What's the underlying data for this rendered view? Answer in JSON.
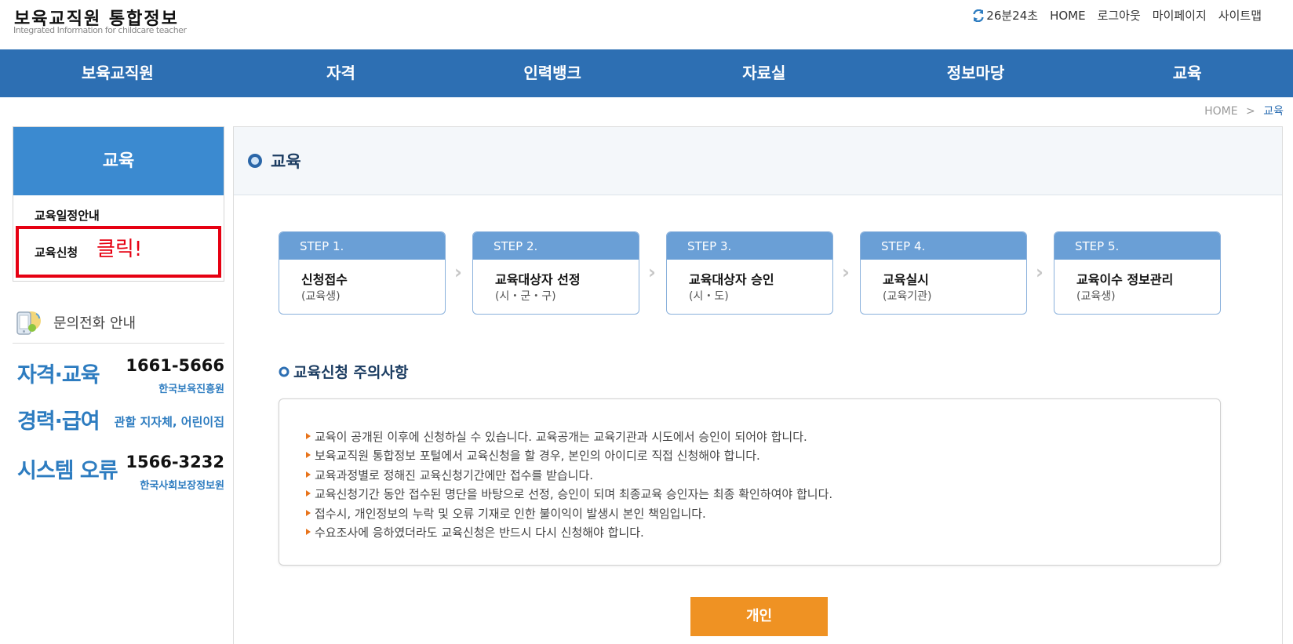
{
  "header": {
    "logo_title": "보육교직원 통합정보",
    "logo_subtitle": "Integrated Information for childcare teacher",
    "timer": "26분24초",
    "links": [
      "HOME",
      "로그아웃",
      "마이페이지",
      "사이트맵"
    ]
  },
  "gnb": [
    "보육교직원",
    "자격",
    "인력뱅크",
    "자료실",
    "정보마당",
    "교육"
  ],
  "breadcrumb": {
    "home": "HOME",
    "separator": ">",
    "current": "교육"
  },
  "sidebar": {
    "title": "교육",
    "items": [
      "교육일정안내",
      "교육신청"
    ],
    "annotation": "클릭!",
    "contact_title": "문의전화 안내",
    "contacts": [
      {
        "category": "자격·교육",
        "phone": "1661-5666",
        "org": "한국보육진흥원"
      },
      {
        "category": "경력·급여",
        "note": "관할 지자체, 어린이집"
      },
      {
        "category": "시스템 오류",
        "phone": "1566-3232",
        "org": "한국사회보장정보원"
      }
    ]
  },
  "main": {
    "title": "교육",
    "steps": [
      {
        "label": "STEP 1.",
        "title": "신청접수",
        "sub": "(교육생)"
      },
      {
        "label": "STEP 2.",
        "title": "교육대상자 선정",
        "sub": "(시・군・구)"
      },
      {
        "label": "STEP 3.",
        "title": "교육대상자 승인",
        "sub": "(시・도)"
      },
      {
        "label": "STEP 4.",
        "title": "교육실시",
        "sub": "(교육기관)"
      },
      {
        "label": "STEP 5.",
        "title": "교육이수 정보관리",
        "sub": "(교육생)"
      }
    ],
    "step_arrow": "›",
    "notice_title": "교육신청 주의사항",
    "notices": [
      "교육이 공개된 이후에 신청하실 수 있습니다. 교육공개는 교육기관과 시도에서 승인이 되어야 합니다.",
      "보육교직원 통합정보 포털에서 교육신청을 할 경우, 본인의 아이디로 직접 신청해야 합니다.",
      "교육과정별로 정해진 교육신청기간에만 접수를 받습니다.",
      "교육신청기간 동안 접수된 명단을 바탕으로 선정, 승인이 되며 최종교육 승인자는 최종 확인하여야 합니다.",
      "접수시, 개인정보의 누락 및 오류 기재로 인한 불이익이 발생시 본인 책임입니다.",
      "수요조사에 응하였더라도 교육신청은 반드시 다시 신청해야 합니다."
    ],
    "button_label": "개인"
  },
  "icons": [
    "refresh-icon",
    "phone-guide-icon",
    "title-bullet-icon",
    "ring-bullet-icon"
  ],
  "colors": {
    "primary": "#2d6fb3",
    "sidebar_head": "#3b8ad0",
    "step_head": "#6a9fd6",
    "button": "#ef9223",
    "highlight": "#e60012"
  }
}
